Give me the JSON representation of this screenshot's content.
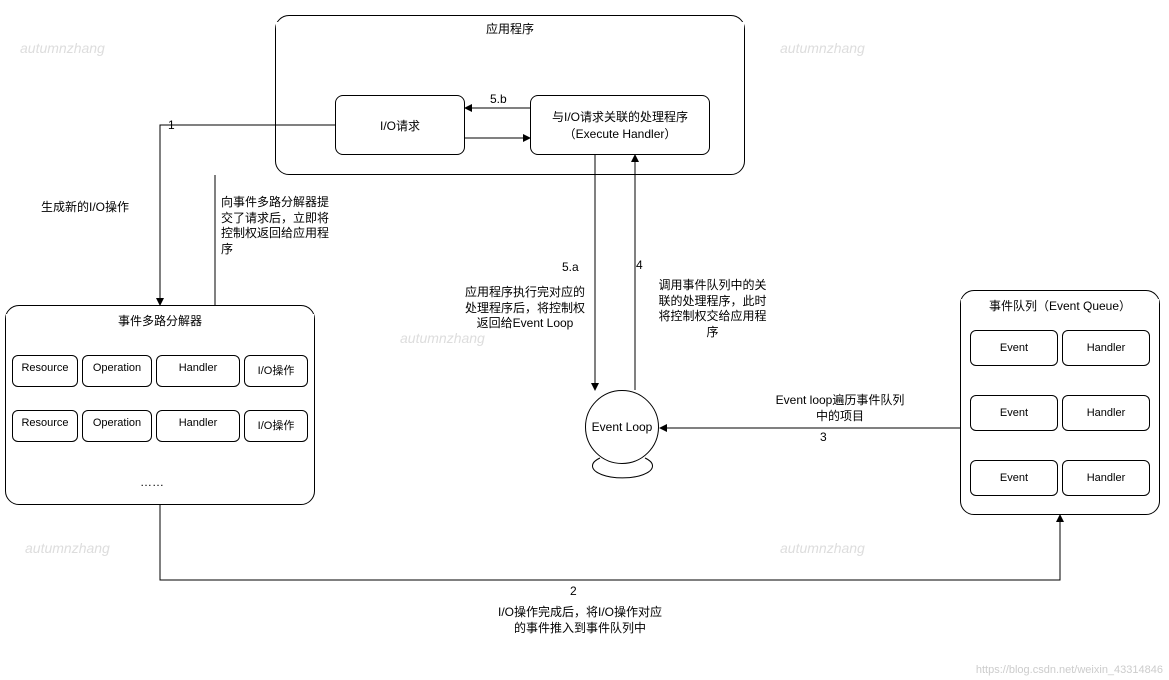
{
  "watermark": "autumnzhang",
  "footer_url": "https://blog.csdn.net/weixin_43314846",
  "application": {
    "title": "应用程序",
    "io_request": "I/O请求",
    "handler": "与I/O请求关联的处理程序（Execute Handler）"
  },
  "demux": {
    "title": "事件多路分解器",
    "columns": [
      "Resource",
      "Operation",
      "Handler",
      "I/O操作"
    ],
    "rows": [
      [
        "Resource",
        "Operation",
        "Handler",
        "I/O操作"
      ],
      [
        "Resource",
        "Operation",
        "Handler",
        "I/O操作"
      ]
    ],
    "ellipsis": "……"
  },
  "event_queue": {
    "title": "事件队列（Event Queue）",
    "rows": [
      [
        "Event",
        "Handler"
      ],
      [
        "Event",
        "Handler"
      ],
      [
        "Event",
        "Handler"
      ]
    ]
  },
  "event_loop": "Event Loop",
  "edges": {
    "e1": {
      "num": "1",
      "text": "生成新的I/O操作"
    },
    "e_submit": {
      "text": "向事件多路分解器提交了请求后，立即将控制权返回给应用程序"
    },
    "e2": {
      "num": "2",
      "text": "I/O操作完成后，将I/O操作对应的事件推入到事件队列中"
    },
    "e3": {
      "num": "3",
      "text": "Event loop遍历事件队列中的项目"
    },
    "e4": {
      "num": "4",
      "text": "调用事件队列中的关联的处理程序，此时将控制权交给应用程序"
    },
    "e5a": {
      "num": "5.a",
      "text": "应用程序执行完对应的处理程序后，将控制权返回给Event Loop"
    },
    "e5b": {
      "num": "5.b"
    }
  }
}
